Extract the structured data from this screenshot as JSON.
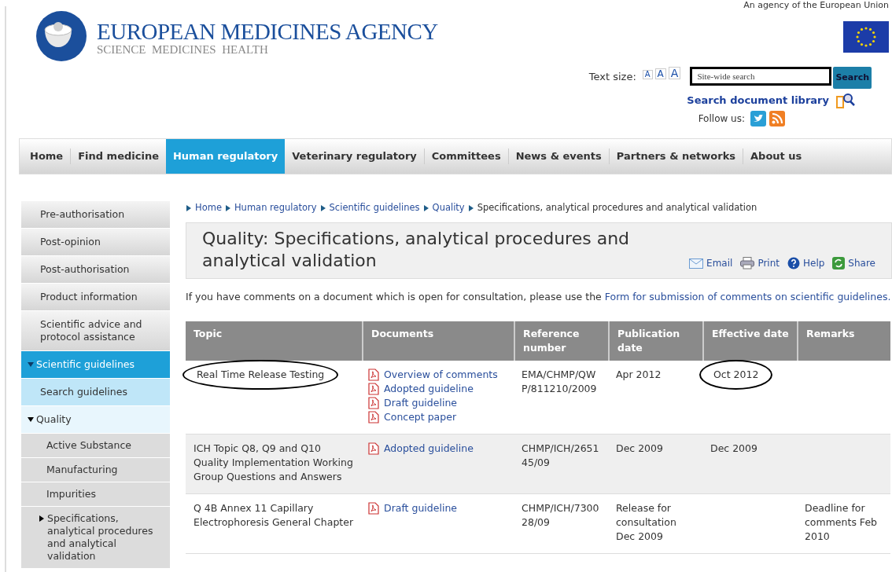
{
  "header": {
    "agency_note": "An agency of the European Union",
    "logo_title": "EUROPEAN MEDICINES AGENCY",
    "logo_subtitle": "SCIENCE  MEDICINES  HEALTH",
    "text_size_label": "Text size:",
    "text_size_buttons": [
      "A",
      "A",
      "A"
    ],
    "search": {
      "placeholder": "Site-wide search",
      "button": "Search"
    },
    "doc_library_link": "Search document library",
    "follow_label": "Follow us:"
  },
  "nav": [
    {
      "label": "Home",
      "selected": false
    },
    {
      "label": "Find medicine",
      "selected": false
    },
    {
      "label": "Human regulatory",
      "selected": true
    },
    {
      "label": "Veterinary regulatory",
      "selected": false
    },
    {
      "label": "Committees",
      "selected": false
    },
    {
      "label": "News & events",
      "selected": false
    },
    {
      "label": "Partners & networks",
      "selected": false
    },
    {
      "label": "About us",
      "selected": false
    }
  ],
  "sidebar": {
    "items": [
      {
        "label": "Pre-authorisation",
        "selected": false
      },
      {
        "label": "Post-opinion",
        "selected": false
      },
      {
        "label": "Post-authorisation",
        "selected": false
      },
      {
        "label": "Product information",
        "selected": false
      },
      {
        "label": "Scientific advice and protocol assistance",
        "selected": false
      },
      {
        "label": "Scientific guidelines",
        "selected": true,
        "expanded": true,
        "children": [
          {
            "label": "Search guidelines",
            "selected": false
          },
          {
            "label": "Quality",
            "selected": false,
            "expanded": true,
            "children": [
              {
                "label": "Active Substance",
                "selected": false
              },
              {
                "label": "Manufacturing",
                "selected": false
              },
              {
                "label": "Impurities",
                "selected": false
              },
              {
                "label": "Specifications, analytical procedures and analytical validation",
                "selected": false,
                "expanded": false
              }
            ]
          }
        ]
      }
    ]
  },
  "breadcrumb": [
    {
      "label": "Home",
      "link": true
    },
    {
      "label": "Human regulatory",
      "link": true
    },
    {
      "label": "Scientific guidelines",
      "link": true
    },
    {
      "label": "Quality",
      "link": true
    },
    {
      "label": "Specifications, analytical procedures and analytical validation",
      "link": false
    }
  ],
  "page_title": "Quality: Specifications, analytical procedures and analytical validation",
  "actions": [
    {
      "kind": "email",
      "label": "Email"
    },
    {
      "kind": "print",
      "label": "Print"
    },
    {
      "kind": "help",
      "label": "Help"
    },
    {
      "kind": "share",
      "label": "Share"
    }
  ],
  "intro": {
    "text": "If you have comments on a document which is open for consultation, please use the ",
    "link": "Form for submission of comments on scientific guidelines."
  },
  "table": {
    "columns": [
      "Topic",
      "Documents",
      "Reference number",
      "Publication date",
      "Effective date",
      "Remarks"
    ],
    "rows": [
      {
        "topic": "Real Time Release Testing",
        "topic_circled": true,
        "documents": [
          "Overview of comments",
          "Adopted guideline",
          "Draft guideline",
          "Concept paper"
        ],
        "reference": "EMA/CHMP/QWP/811210/2009",
        "publication": "Apr 2012",
        "effective": "Oct 2012",
        "effective_circled": true
      },
      {
        "topic": "ICH Topic Q8, Q9 and Q10 Quality Implementation Working Group Questions and Answers",
        "topic_circled": false,
        "documents": [
          "Adopted guideline"
        ],
        "reference": "CHMP/ICH/265145/09",
        "publication": "Dec 2009",
        "effective": "Dec 2009",
        "effective_circled": false
      },
      {
        "topic": "Q 4B Annex 11 Capillary Electrophoresis General Chapter",
        "topic_circled": false,
        "documents": [
          "Draft guideline"
        ],
        "reference": "CHMP/ICH/730028/09",
        "publication": "Release for consultation Dec 2009",
        "remarks": "Deadline for comments Feb 2010"
      }
    ]
  }
}
